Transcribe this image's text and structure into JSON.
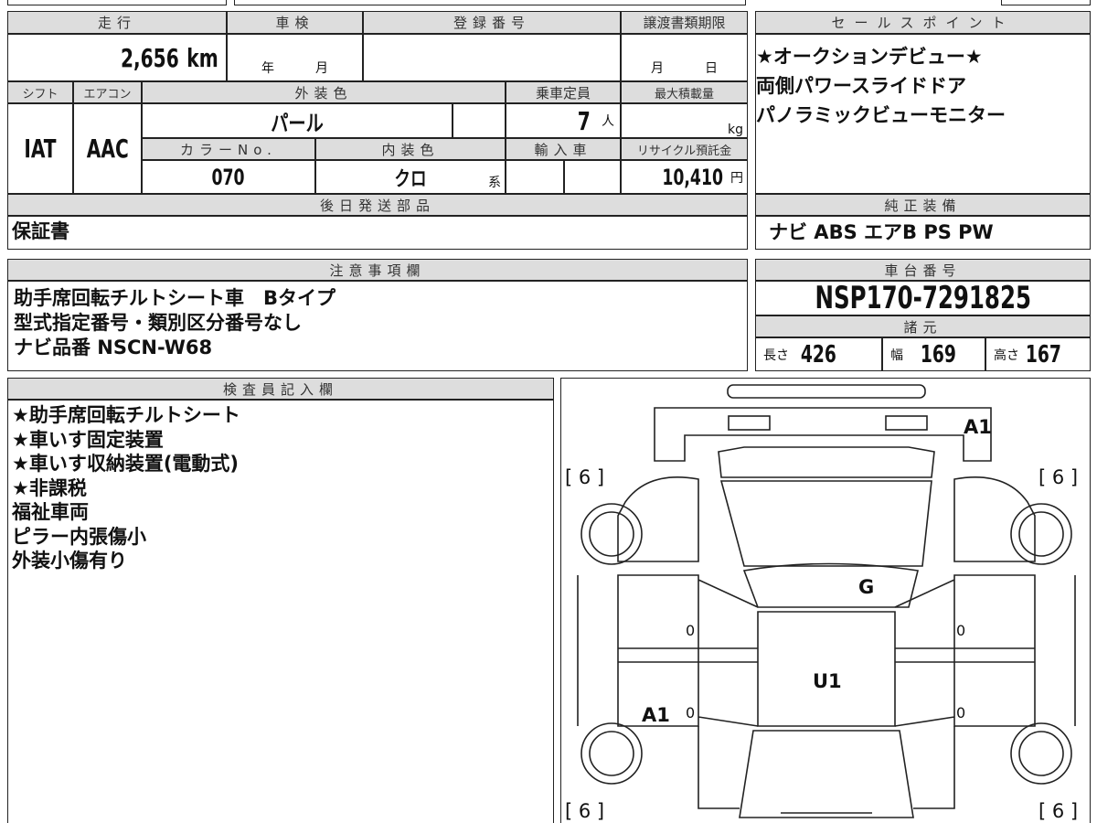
{
  "headers": {
    "mileage": "走行",
    "inspection": "車検",
    "registration": "登録番号",
    "transfer_deadline": "譲渡書類期限",
    "shift": "シフト",
    "aircon": "エアコン",
    "exterior": "外装色",
    "capacity": "乗車定員",
    "max_load": "最大積載量",
    "color_no": "カラーNo.",
    "interior": "内装色",
    "import": "輸入車",
    "recycle": "リサイクル預託金",
    "later_parts": "後日発送部品",
    "sales_point": "セールスポイント",
    "equipment": "純正装備",
    "notes": "注意事項欄",
    "chassis": "車台番号",
    "specs": "諸元",
    "inspector": "検査員記入欄"
  },
  "values": {
    "mileage": "2,656",
    "mileage_unit": "km",
    "year_unit": "年",
    "month_unit": "月",
    "deadline_month": "月",
    "deadline_day": "日",
    "shift": "IAT",
    "aircon": "AAC",
    "exterior": "パール",
    "capacity": "7",
    "capacity_unit": "人",
    "load_unit": "kg",
    "color_no": "070",
    "interior": "クロ",
    "interior_suffix": "系",
    "recycle": "10,410",
    "recycle_unit": "円",
    "later_parts": "保証書",
    "equipment": "ナビ ABS エアB PS PW",
    "chassis": "NSP170-7291825",
    "length_label": "長さ",
    "length": "426",
    "width_label": "幅",
    "width": "169",
    "height_label": "高さ",
    "height": "167"
  },
  "sales_points": [
    "★オークションデビュー★",
    "両側パワースライドドア",
    "パノラミックビューモニター"
  ],
  "notes": [
    "助手席回転チルトシート車　Bタイプ",
    "型式指定番号・類別区分番号なし",
    "ナビ品番 NSCN-W68"
  ],
  "inspector": [
    "★助手席回転チルトシート",
    "★車いす固定装置",
    "★車いす収納装置(電動式)",
    "★非課税",
    "福祉車両",
    "ピラー内張傷小",
    "外装小傷有り"
  ],
  "diagram": {
    "front": "A1",
    "hood": "G",
    "roof": "U1",
    "left_rear": "A1",
    "tire_fl": "[ 6 ]",
    "tire_fr": "[ 6 ]",
    "tire_rl": "[ 6 ]",
    "tire_rr": "[ 6 ]",
    "zero": "0"
  }
}
